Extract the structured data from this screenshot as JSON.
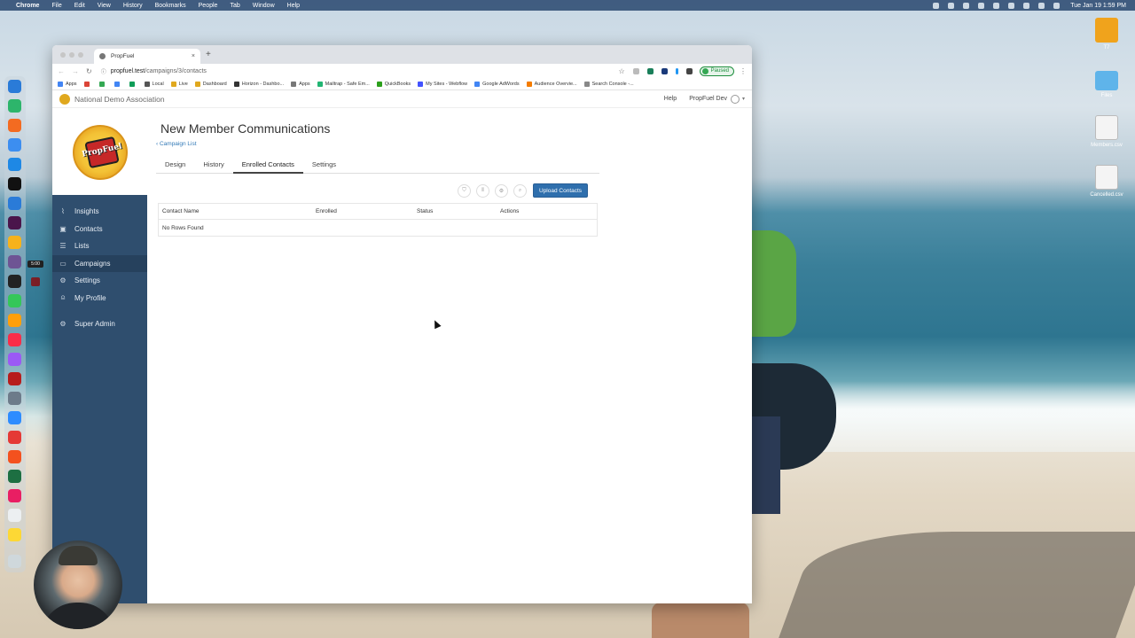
{
  "menubar": {
    "app": "Chrome",
    "items": [
      "File",
      "Edit",
      "View",
      "History",
      "Bookmarks",
      "People",
      "Tab",
      "Window",
      "Help"
    ],
    "clock": "Tue Jan 19  1:59 PM"
  },
  "dock": {
    "timer": "5:00"
  },
  "desktop_files": [
    {
      "label": "T7",
      "color": "#f0a31c"
    },
    {
      "label": "Files",
      "color": "#5fb4ea"
    },
    {
      "label": "Members.csv",
      "color": "#f4f4f4"
    },
    {
      "label": "Cancelled.csv",
      "color": "#f4f4f4"
    }
  ],
  "browser": {
    "tab_title": "PropFuel",
    "tab_close": "×",
    "new_tab": "+",
    "url_host": "propfuel.test",
    "url_path": "/campaigns/3/contacts",
    "paused_label": "Paused",
    "bookmarks": [
      {
        "label": "Apps",
        "color": "#4285f4"
      },
      {
        "label": "",
        "color": "#db4437"
      },
      {
        "label": "",
        "color": "#34a853"
      },
      {
        "label": "",
        "color": "#4285f4"
      },
      {
        "label": "",
        "color": "#0f9d58"
      },
      {
        "label": "Local",
        "color": "#555555"
      },
      {
        "label": "Live",
        "color": "#e0a81e"
      },
      {
        "label": "Dashboard",
        "color": "#e0a81e"
      },
      {
        "label": "Horizon - Dashbo...",
        "color": "#333333"
      },
      {
        "label": "Apps",
        "color": "#777777"
      },
      {
        "label": "Mailtrap - Safe Em...",
        "color": "#22b573"
      },
      {
        "label": "QuickBooks",
        "color": "#2ca01c"
      },
      {
        "label": "My Sites - Webflow",
        "color": "#4353ff"
      },
      {
        "label": "Google AdWords",
        "color": "#4285f4"
      },
      {
        "label": "Audience Overvie...",
        "color": "#f57c00"
      },
      {
        "label": "Search Console -...",
        "color": "#888888"
      }
    ]
  },
  "app": {
    "org_name": "National Demo Association",
    "help": "Help",
    "user": "PropFuel Dev",
    "logo_text": "PropFuel",
    "sidebar": [
      {
        "label": "Insights",
        "icon": "chart-icon",
        "glyph": "⌇",
        "active": false
      },
      {
        "label": "Contacts",
        "icon": "contacts-icon",
        "glyph": "▣",
        "active": false
      },
      {
        "label": "Lists",
        "icon": "list-icon",
        "glyph": "☰",
        "active": false
      },
      {
        "label": "Campaigns",
        "icon": "message-icon",
        "glyph": "▭",
        "active": true
      },
      {
        "label": "Settings",
        "icon": "gear-icon",
        "glyph": "⚙",
        "active": false
      },
      {
        "label": "My Profile",
        "icon": "user-icon",
        "glyph": "⍝",
        "active": false
      }
    ],
    "sidebar_admin": {
      "label": "Super Admin",
      "icon": "admin-gear-icon",
      "glyph": "⚙"
    },
    "page_title": "New Member Communications",
    "back_link": "‹ Campaign List",
    "tabs": [
      {
        "label": "Design",
        "active": false
      },
      {
        "label": "History",
        "active": false
      },
      {
        "label": "Enrolled Contacts",
        "active": true
      },
      {
        "label": "Settings",
        "active": false
      }
    ],
    "toolbar_icons": [
      {
        "name": "filter-icon",
        "glyph": "⛉"
      },
      {
        "name": "columns-icon",
        "glyph": "⦀"
      },
      {
        "name": "settings-icon",
        "glyph": "⚙"
      },
      {
        "name": "search-icon",
        "glyph": "⌕"
      }
    ],
    "upload_button": "Upload Contacts",
    "table": {
      "columns": [
        "Contact Name",
        "Enrolled",
        "Status",
        "Actions"
      ],
      "empty_text": "No Rows Found"
    }
  }
}
